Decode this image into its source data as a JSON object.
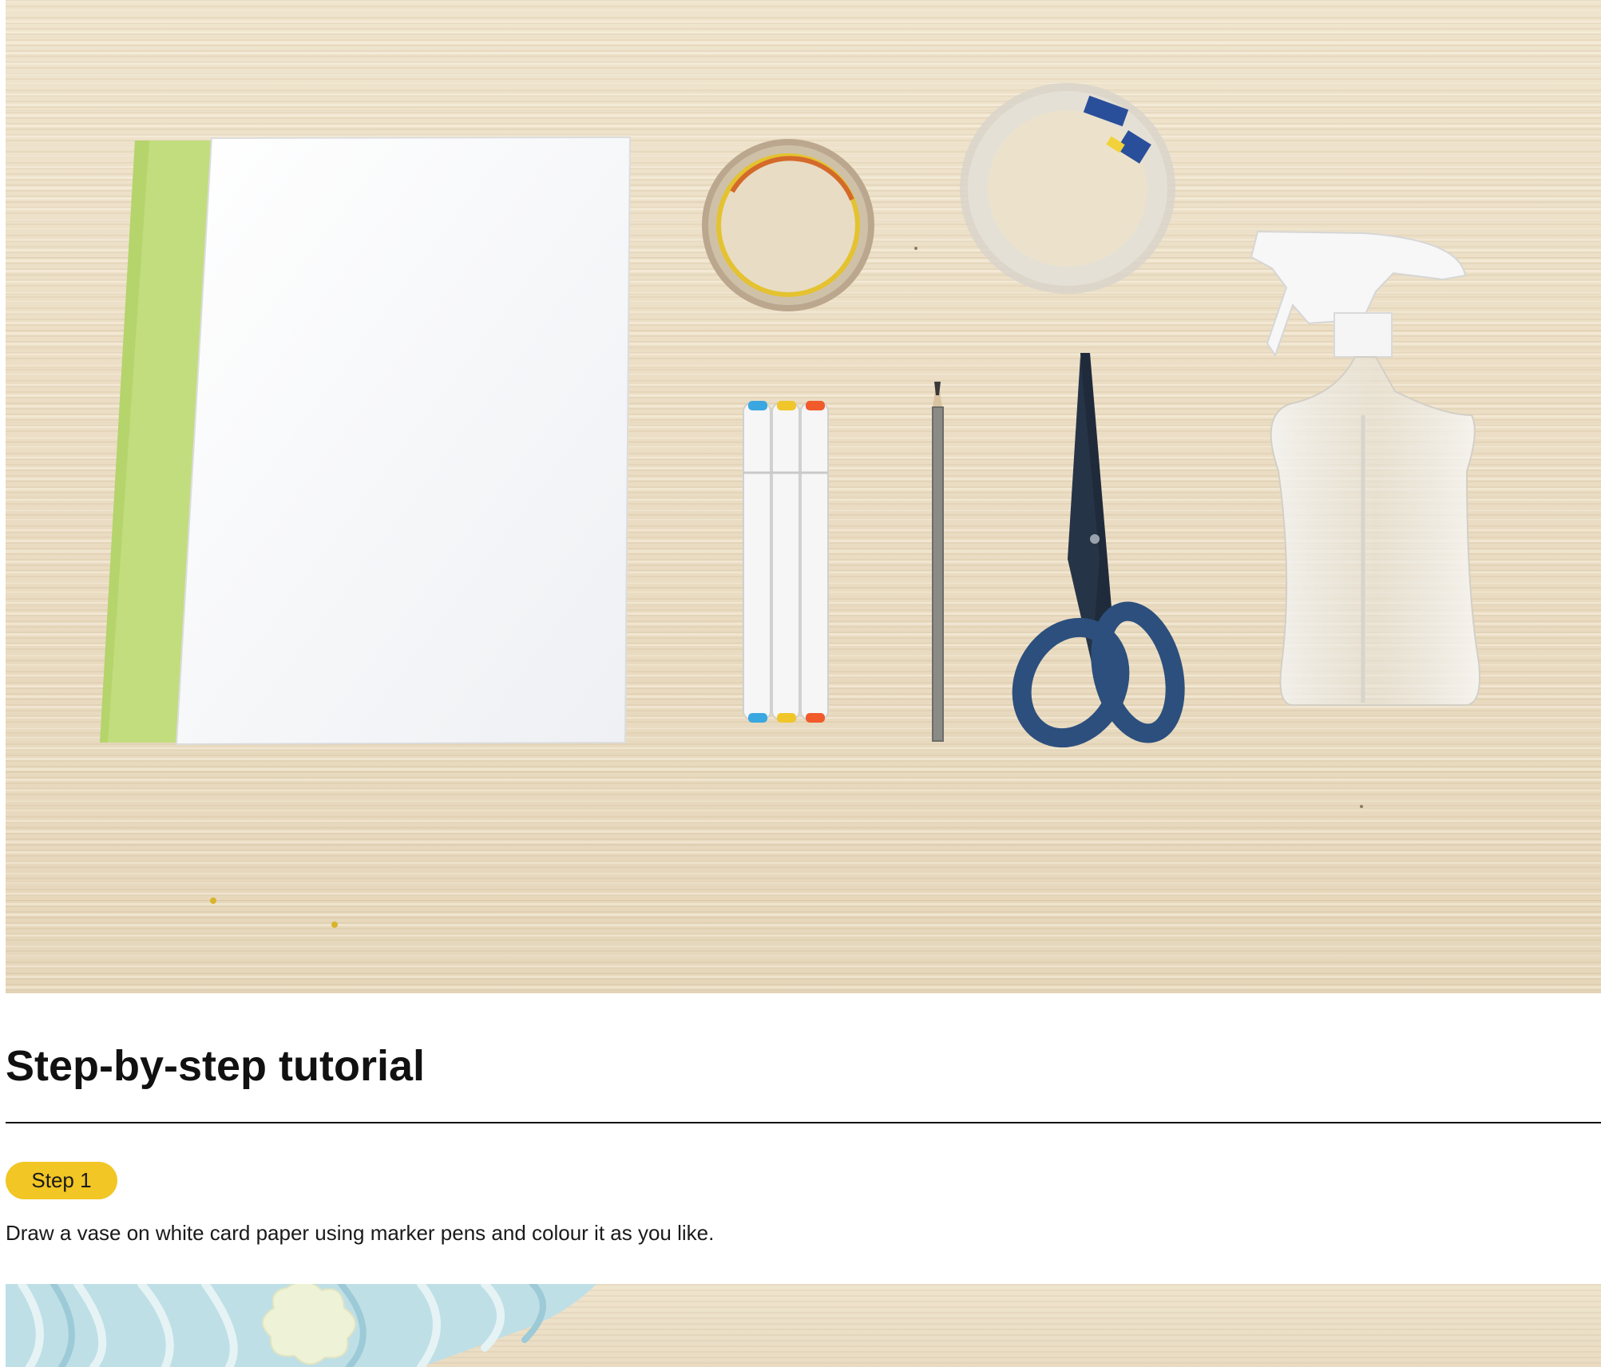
{
  "main": {
    "heading": "Step-by-step tutorial",
    "steps": [
      {
        "badge": "Step 1",
        "text": "Draw a vase on white card paper using marker pens and colour it as you like."
      }
    ]
  },
  "colors": {
    "badge": "#f2c624",
    "heading": "#111111",
    "wood": "#ece0c8"
  },
  "materials_photo": {
    "items": [
      "white-card-paper",
      "green-card-paper",
      "masking-tape",
      "clear-tape",
      "marker-pens",
      "pencil",
      "scissors",
      "spray-bottle"
    ]
  }
}
